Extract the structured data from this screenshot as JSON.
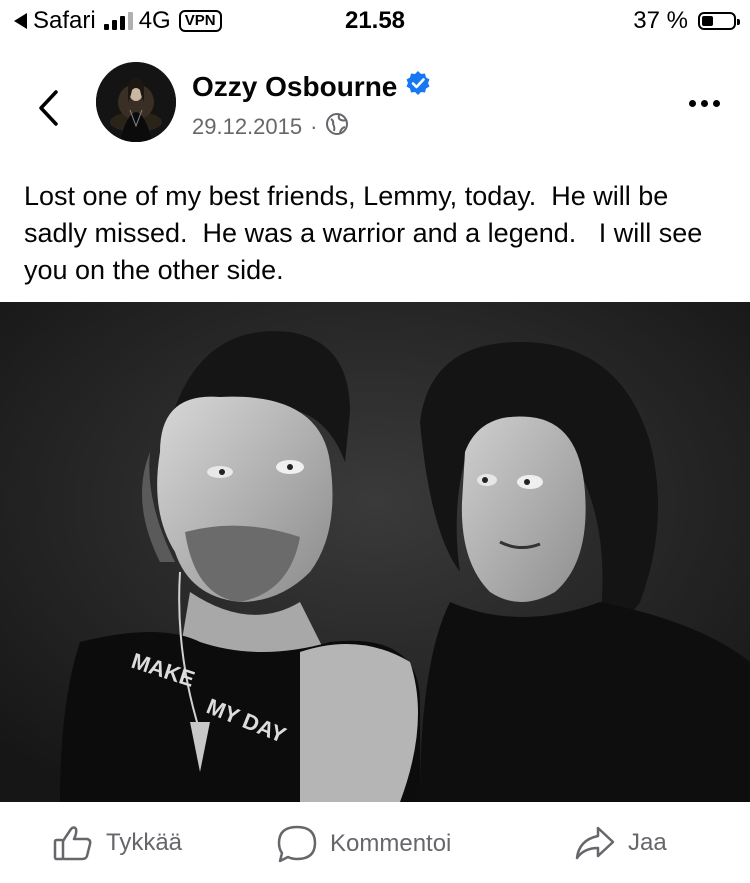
{
  "status_bar": {
    "back_app": "Safari",
    "network": "4G",
    "vpn": "VPN",
    "time": "21.58",
    "battery_percent": "37 %",
    "battery_level": 0.37
  },
  "post": {
    "author": "Ozzy Osbourne",
    "verified": true,
    "date": "29.12.2015",
    "separator": "·",
    "text": "Lost one of my best friends, Lemmy, today.  He will be sadly missed.  He was a warrior and a legend.   I will see you on the other side.",
    "photo_text": [
      "MAKE",
      "MY DAY"
    ]
  },
  "actions": {
    "like": "Tykkää",
    "comment": "Kommentoi",
    "share": "Jaa"
  },
  "icons": {
    "back": "chevron-left-icon",
    "more": "more-horizontal-icon",
    "verified": "verified-badge-icon",
    "audience": "globe-icon",
    "like": "thumbs-up-icon",
    "comment": "comment-bubble-icon",
    "share": "share-arrow-icon"
  },
  "colors": {
    "verified": "#1877f2",
    "secondary_text": "#65676b",
    "text": "#050505"
  }
}
